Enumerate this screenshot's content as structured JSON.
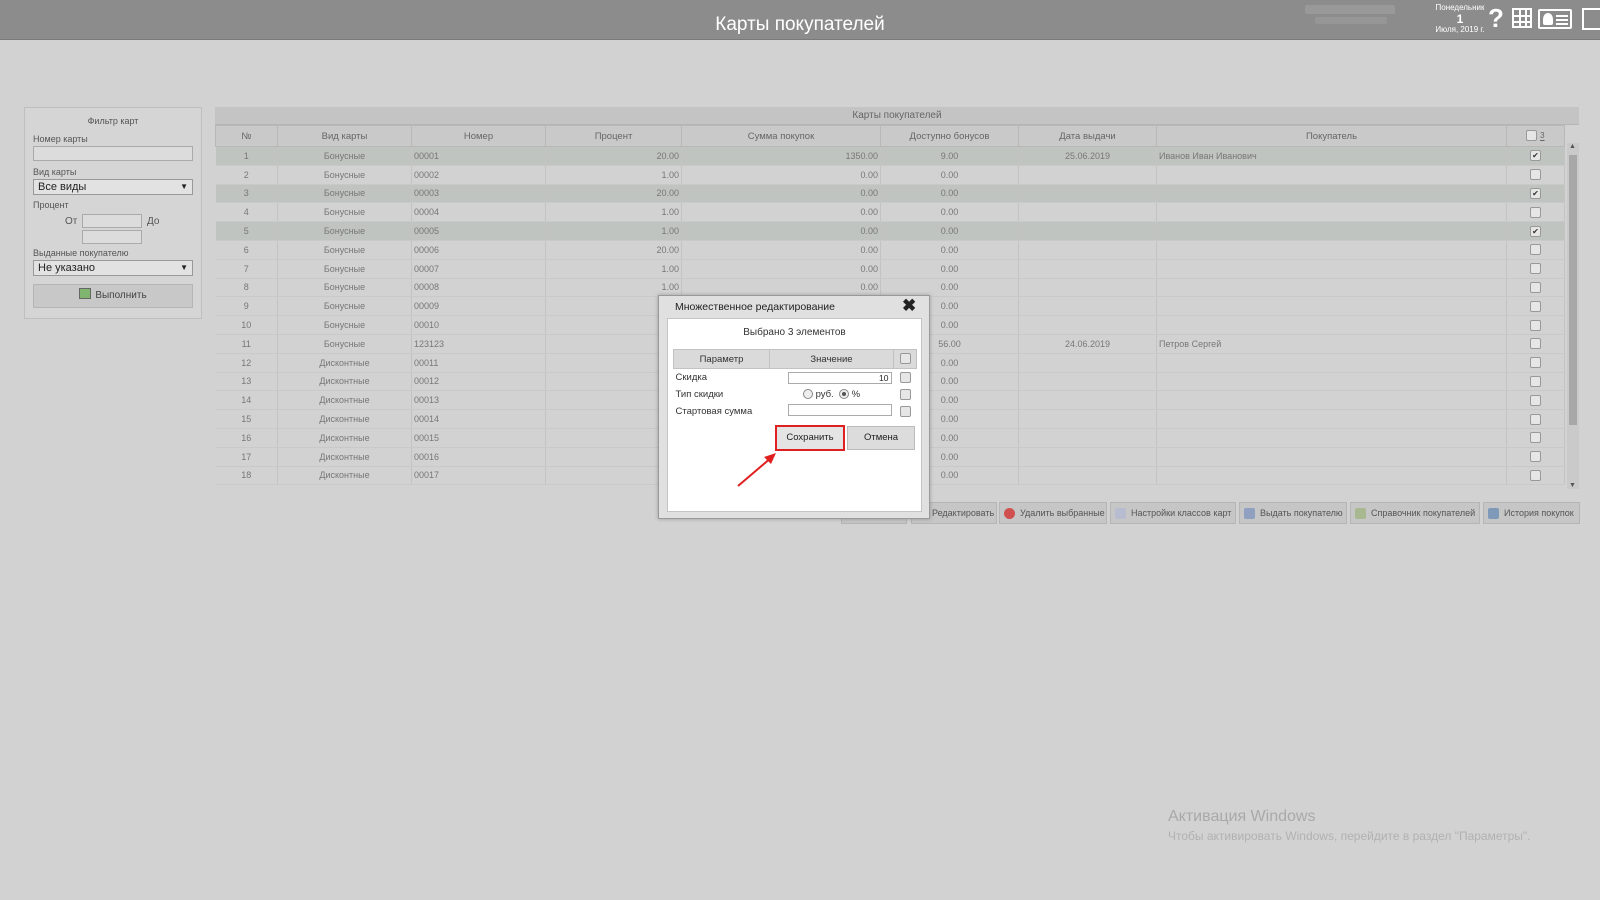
{
  "app_title": "Карты покупателей",
  "date": {
    "weekday": "Понедельник",
    "day": "1",
    "month_year": "Июля, 2019 г."
  },
  "help_glyph": "?",
  "filter": {
    "title": "Фильтр карт",
    "card_number_label": "Номер карты",
    "card_number_value": "",
    "card_type_label": "Вид карты",
    "card_type_value": "Все виды",
    "percent_label": "Процент",
    "from_label": "От",
    "to_label": "До",
    "issued_label": "Выданные покупателю",
    "issued_value": "Не указано",
    "execute_label": "Выполнить"
  },
  "grid": {
    "caption": "Карты покупателей",
    "columns": [
      "№",
      "Вид карты",
      "Номер",
      "Процент",
      "Сумма покупок",
      "Доступно бонусов",
      "Дата выдачи",
      "Покупатель"
    ],
    "selected_count": "3",
    "rows": [
      {
        "n": "1",
        "type": "Бонусные",
        "num": "00001",
        "pct": "20.00",
        "sum": "1350.00",
        "bonus": "9.00",
        "date": "25.06.2019",
        "buyer": "Иванов Иван Иванович",
        "checked": true
      },
      {
        "n": "2",
        "type": "Бонусные",
        "num": "00002",
        "pct": "1.00",
        "sum": "0.00",
        "bonus": "0.00",
        "date": "",
        "buyer": "",
        "checked": false
      },
      {
        "n": "3",
        "type": "Бонусные",
        "num": "00003",
        "pct": "20.00",
        "sum": "0.00",
        "bonus": "0.00",
        "date": "",
        "buyer": "",
        "checked": true
      },
      {
        "n": "4",
        "type": "Бонусные",
        "num": "00004",
        "pct": "1.00",
        "sum": "0.00",
        "bonus": "0.00",
        "date": "",
        "buyer": "",
        "checked": false
      },
      {
        "n": "5",
        "type": "Бонусные",
        "num": "00005",
        "pct": "1.00",
        "sum": "0.00",
        "bonus": "0.00",
        "date": "",
        "buyer": "",
        "checked": true
      },
      {
        "n": "6",
        "type": "Бонусные",
        "num": "00006",
        "pct": "20.00",
        "sum": "0.00",
        "bonus": "0.00",
        "date": "",
        "buyer": "",
        "checked": false
      },
      {
        "n": "7",
        "type": "Бонусные",
        "num": "00007",
        "pct": "1.00",
        "sum": "0.00",
        "bonus": "0.00",
        "date": "",
        "buyer": "",
        "checked": false
      },
      {
        "n": "8",
        "type": "Бонусные",
        "num": "00008",
        "pct": "1.00",
        "sum": "0.00",
        "bonus": "0.00",
        "date": "",
        "buyer": "",
        "checked": false
      },
      {
        "n": "9",
        "type": "Бонусные",
        "num": "00009",
        "pct": "",
        "sum": "",
        "bonus": "0.00",
        "date": "",
        "buyer": "",
        "checked": false
      },
      {
        "n": "10",
        "type": "Бонусные",
        "num": "00010",
        "pct": "",
        "sum": "",
        "bonus": "0.00",
        "date": "",
        "buyer": "",
        "checked": false
      },
      {
        "n": "11",
        "type": "Бонусные",
        "num": "123123",
        "pct": "",
        "sum": "",
        "bonus": "56.00",
        "date": "24.06.2019",
        "buyer": "Петров Сергей",
        "checked": false
      },
      {
        "n": "12",
        "type": "Дисконтные",
        "num": "00011",
        "pct": "",
        "sum": "",
        "bonus": "0.00",
        "date": "",
        "buyer": "",
        "checked": false
      },
      {
        "n": "13",
        "type": "Дисконтные",
        "num": "00012",
        "pct": "",
        "sum": "",
        "bonus": "0.00",
        "date": "",
        "buyer": "",
        "checked": false
      },
      {
        "n": "14",
        "type": "Дисконтные",
        "num": "00013",
        "pct": "",
        "sum": "",
        "bonus": "0.00",
        "date": "",
        "buyer": "",
        "checked": false
      },
      {
        "n": "15",
        "type": "Дисконтные",
        "num": "00014",
        "pct": "",
        "sum": "",
        "bonus": "0.00",
        "date": "",
        "buyer": "",
        "checked": false
      },
      {
        "n": "16",
        "type": "Дисконтные",
        "num": "00015",
        "pct": "",
        "sum": "",
        "bonus": "0.00",
        "date": "",
        "buyer": "",
        "checked": false
      },
      {
        "n": "17",
        "type": "Дисконтные",
        "num": "00016",
        "pct": "",
        "sum": "",
        "bonus": "0.00",
        "date": "",
        "buyer": "",
        "checked": false
      },
      {
        "n": "18",
        "type": "Дисконтные",
        "num": "00017",
        "pct": "",
        "sum": "",
        "bonus": "0.00",
        "date": "",
        "buyer": "",
        "checked": false
      }
    ]
  },
  "toolbar": {
    "edit": "Редактировать",
    "delete": "Удалить выбранные",
    "classes": "Настройки классов карт",
    "issue": "Выдать покупателю",
    "directory": "Справочник покупателей",
    "history": "История покупок"
  },
  "dialog": {
    "title": "Множественное редактирование",
    "close_glyph": "✖",
    "subtitle": "Выбрано 3 элементов",
    "col_param": "Параметр",
    "col_value": "Значение",
    "rows": {
      "discount_label": "Скидка",
      "discount_value": "10",
      "type_label": "Тип скидки",
      "rub_label": "руб.",
      "pct_label": "%",
      "start_label": "Стартовая сумма",
      "start_value": ""
    },
    "save": "Сохранить",
    "cancel": "Отмена"
  },
  "windows": {
    "title": "Активация Windows",
    "subtitle": "Чтобы активировать Windows, перейдите в раздел \"Параметры\"."
  },
  "colors": {
    "topbar": "#8c8c8c",
    "highlight": "#e02020",
    "selected_row": "#bfc4c0"
  }
}
